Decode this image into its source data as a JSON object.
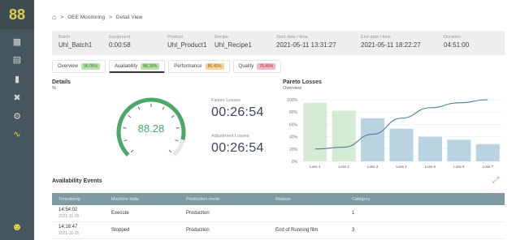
{
  "sidebar": {
    "logo": "88",
    "icons": [
      "save-icon",
      "server-icon",
      "bar-chart-icon",
      "tools-icon",
      "settings-icon",
      "flow-icon"
    ],
    "active_index": 5,
    "user_icon": "user-icon"
  },
  "breadcrumb": {
    "items": [
      "OEE Monitoring",
      "Detail View"
    ],
    "separator": ">"
  },
  "info": {
    "batch": {
      "label": "Batch",
      "value": "Uhl_Batch1"
    },
    "equipment": {
      "label": "Equipment",
      "value": "0:00:58"
    },
    "product": {
      "label": "Product",
      "value": "Uhl_Product1"
    },
    "recipe": {
      "label": "Recipe",
      "value": "Uhl_Recipe1"
    },
    "start": {
      "label": "Start date / time",
      "value": "2021-05-11 13:31:27"
    },
    "end": {
      "label": "End date / time",
      "value": "2021-05-11 18:22:27"
    },
    "duration": {
      "label": "Duration",
      "value": "04:51:00"
    }
  },
  "tabs": [
    {
      "label": "Overview",
      "badge": "96.05%",
      "color": "green"
    },
    {
      "label": "Availability",
      "badge": "88.28%",
      "color": "green"
    },
    {
      "label": "Performance",
      "badge": "86.45%",
      "color": "orange"
    },
    {
      "label": "Quality",
      "badge": "76.45%",
      "color": "pink"
    }
  ],
  "details": {
    "title": "Details",
    "unit": "%",
    "gauge_value": "88.28",
    "gauge_fraction": 0.8828,
    "failure_label": "Failure Losses",
    "failure_value": "00:26:54",
    "adjustment_label": "Adjustment Losses",
    "adjustment_value": "00:26:54"
  },
  "pareto": {
    "title": "Pareto Losses",
    "subtitle": "Overview"
  },
  "chart_data": {
    "type": "bar",
    "title": "Pareto Losses",
    "subtitle": "Overview",
    "categories": [
      "Loss 1",
      "Loss 2",
      "Loss 3",
      "Loss 4",
      "Loss 5",
      "Loss 6",
      "Loss 7"
    ],
    "values": [
      95,
      82,
      70,
      53,
      40,
      35,
      28
    ],
    "colors": [
      "#d6ebd3",
      "#d6ebd3",
      "#b9d3e0",
      "#b9d3e0",
      "#b9d3e0",
      "#b9d3e0",
      "#b9d3e0"
    ],
    "cumulative": [
      20,
      23,
      44,
      70,
      87,
      95,
      100
    ],
    "yticks": [
      "0%",
      "20%",
      "40%",
      "60%",
      "80%",
      "100%"
    ],
    "ylim": [
      0,
      100
    ],
    "grid": true
  },
  "events": {
    "title": "Availability Events",
    "columns": [
      "Timestamp",
      "Machine state",
      "Production mode",
      "Reason",
      "Category"
    ],
    "rows": [
      {
        "time": "14:54:02",
        "date": "2021-11-15",
        "state": "Execute",
        "mode": "Production",
        "reason": "",
        "category": "1"
      },
      {
        "time": "14:18:47",
        "date": "2021-11-15",
        "state": "Stopped",
        "mode": "Production",
        "reason": "End of Running film",
        "category": "3"
      }
    ]
  },
  "colors": {
    "sidebar": "#46565f",
    "accent": "#e8d64a",
    "gauge": "#4ca86a",
    "table_header": "#7f9aa2"
  }
}
